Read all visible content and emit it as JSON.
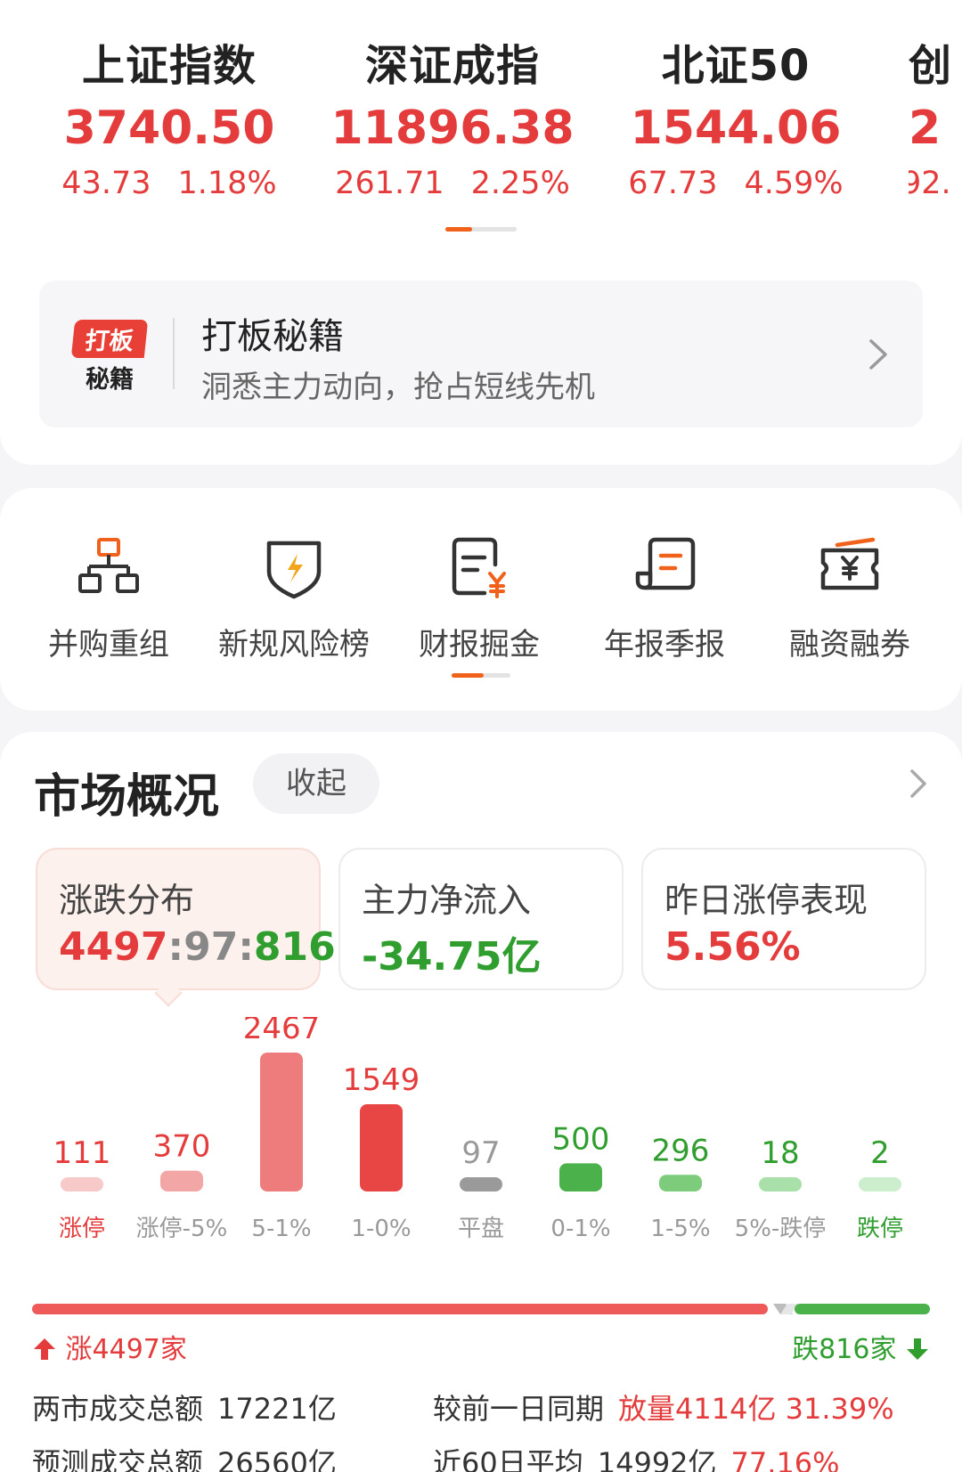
{
  "indices": [
    {
      "name": "上证指数",
      "price": "3740.50",
      "change": "43.73",
      "pct": "1.18%"
    },
    {
      "name": "深证成指",
      "price": "11896.38",
      "change": "261.71",
      "pct": "2.25%"
    },
    {
      "name": "北证50",
      "price": "1544.06",
      "change": "67.73",
      "pct": "4.59%"
    },
    {
      "name": "创",
      "price": "2",
      "change": "92.",
      "pct": ""
    }
  ],
  "promo": {
    "logo_line1": "打板",
    "logo_line2": "秘籍",
    "title": "打板秘籍",
    "subtitle": "洞悉主力动向，抢占短线先机"
  },
  "shortcuts": [
    {
      "label": "并购重组",
      "icon": "org-chart-icon"
    },
    {
      "label": "新规风险榜",
      "icon": "shield-lightning-icon"
    },
    {
      "label": "财报掘金",
      "icon": "report-yuan-icon"
    },
    {
      "label": "年报季报",
      "icon": "scroll-document-icon"
    },
    {
      "label": "融资融券",
      "icon": "yuan-ticket-icon"
    }
  ],
  "market": {
    "title": "市场概况",
    "collapse_label": "收起",
    "stats": [
      {
        "label": "涨跌分布",
        "up": "4497",
        "flat": "97",
        "down": "816"
      },
      {
        "label": "主力净流入",
        "value": "-34.75亿"
      },
      {
        "label": "昨日涨停表现",
        "value": "5.56%"
      }
    ],
    "up_count_label": "涨4497家",
    "down_count_label": "跌816家",
    "summary": [
      {
        "label": "两市成交总额",
        "value": "17221亿",
        "label2": "较前一日同期",
        "value2": "放量4114亿 31.39%"
      },
      {
        "label": "预测成交总额",
        "value": "26560亿",
        "label2": "近60日平均",
        "value2": "14992亿",
        "value3": "77.16%"
      }
    ]
  },
  "chart_data": {
    "type": "bar",
    "categories": [
      "涨停",
      "涨停-5%",
      "5-1%",
      "1-0%",
      "平盘",
      "0-1%",
      "1-5%",
      "5%-跌停",
      "跌停"
    ],
    "values": [
      111,
      370,
      2467,
      1549,
      97,
      500,
      296,
      18,
      2
    ],
    "colors": [
      "#f7c9c9",
      "#f3a6a6",
      "#ee7c7c",
      "#e84545",
      "#9a9a9a",
      "#4bb24b",
      "#7ccc7c",
      "#a9dfa9",
      "#cdeecd"
    ],
    "label_colors": [
      "#e43c3c",
      "#e43c3c",
      "#e43c3c",
      "#e43c3c",
      "#999999",
      "#2f9e2f",
      "#2f9e2f",
      "#2f9e2f",
      "#2f9e2f"
    ],
    "category_colors": [
      "#e43c3c",
      "#999999",
      "#999999",
      "#999999",
      "#999999",
      "#999999",
      "#999999",
      "#999999",
      "#2f9e2f"
    ]
  },
  "colors": {
    "up": "#e43c3c",
    "down": "#2f9e2f",
    "accent": "#f0621c"
  }
}
